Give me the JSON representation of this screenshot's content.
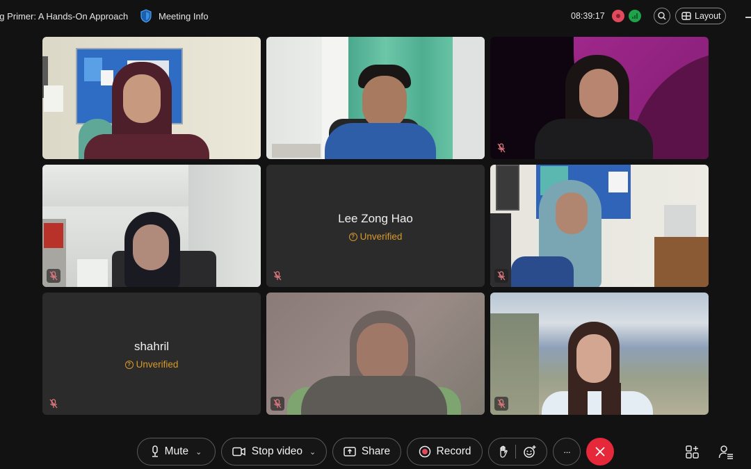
{
  "window": {
    "meeting_title": "ng Primer: A Hands-On Approach",
    "meeting_info_label": "Meeting Info",
    "clock": "08:39:17",
    "layout_label": "Layout"
  },
  "colors": {
    "background": "#121212",
    "tile": "#2b2b2b",
    "unverified": "#d99a2a",
    "end_call": "#e5283a",
    "recording": "#e04a5c",
    "network_ok": "#1fa34a",
    "muted_icon": "#e07a80"
  },
  "participants": [
    {
      "id": 1,
      "video": true,
      "muted": false
    },
    {
      "id": 2,
      "video": true,
      "muted": false
    },
    {
      "id": 3,
      "video": true,
      "muted": true
    },
    {
      "id": 4,
      "video": true,
      "muted": true
    },
    {
      "id": 5,
      "video": false,
      "muted": true,
      "name": "Lee Zong Hao",
      "status": "Unverified"
    },
    {
      "id": 6,
      "video": true,
      "muted": true
    },
    {
      "id": 7,
      "video": false,
      "muted": true,
      "name": "shahril",
      "status": "Unverified"
    },
    {
      "id": 8,
      "video": true,
      "muted": true
    },
    {
      "id": 9,
      "video": true,
      "muted": true
    }
  ],
  "toolbar": {
    "mute_label": "Mute",
    "stop_video_label": "Stop video",
    "share_label": "Share",
    "record_label": "Record",
    "more_label": "···"
  },
  "icons": {
    "meeting_info": "shield-icon",
    "recording": "record-icon",
    "network": "signal-icon",
    "search": "search-icon",
    "layout": "grid-icon",
    "mic": "microphone-icon",
    "video": "video-camera-icon",
    "share": "share-screen-icon",
    "record": "record-icon",
    "raise_hand": "hand-icon",
    "reactions": "emoji-icon",
    "more": "more-icon",
    "end": "close-icon",
    "apps": "apps-add-icon",
    "participants": "participants-icon",
    "tile_muted": "microphone-muted-icon",
    "unverified": "question-circle-icon"
  }
}
